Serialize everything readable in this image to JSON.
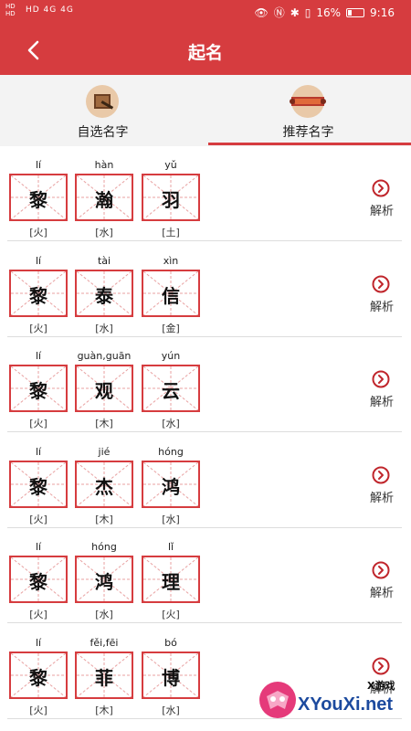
{
  "status_bar": {
    "left_indicators": "HD 4G 4G",
    "battery": "16%",
    "time": "9:16"
  },
  "header": {
    "title": "起名"
  },
  "tabs": [
    {
      "label": "自选名字",
      "active": false
    },
    {
      "label": "推荐名字",
      "active": true
    }
  ],
  "names": [
    {
      "chars": [
        {
          "pinyin": "lí",
          "hanzi": "黎",
          "element": "[火]"
        },
        {
          "pinyin": "hàn",
          "hanzi": "瀚",
          "element": "[水]"
        },
        {
          "pinyin": "yǔ",
          "hanzi": "羽",
          "element": "[土]"
        }
      ],
      "action": "解析"
    },
    {
      "chars": [
        {
          "pinyin": "lí",
          "hanzi": "黎",
          "element": "[火]"
        },
        {
          "pinyin": "tài",
          "hanzi": "泰",
          "element": "[水]"
        },
        {
          "pinyin": "xìn",
          "hanzi": "信",
          "element": "[金]"
        }
      ],
      "action": "解析"
    },
    {
      "chars": [
        {
          "pinyin": "lí",
          "hanzi": "黎",
          "element": "[火]"
        },
        {
          "pinyin": "guàn,guān",
          "hanzi": "观",
          "element": "[木]"
        },
        {
          "pinyin": "yún",
          "hanzi": "云",
          "element": "[水]"
        }
      ],
      "action": "解析"
    },
    {
      "chars": [
        {
          "pinyin": "lí",
          "hanzi": "黎",
          "element": "[火]"
        },
        {
          "pinyin": "jié",
          "hanzi": "杰",
          "element": "[木]"
        },
        {
          "pinyin": "hóng",
          "hanzi": "鸿",
          "element": "[水]"
        }
      ],
      "action": "解析"
    },
    {
      "chars": [
        {
          "pinyin": "lí",
          "hanzi": "黎",
          "element": "[火]"
        },
        {
          "pinyin": "hóng",
          "hanzi": "鸿",
          "element": "[水]"
        },
        {
          "pinyin": "lǐ",
          "hanzi": "理",
          "element": "[火]"
        }
      ],
      "action": "解析"
    },
    {
      "chars": [
        {
          "pinyin": "lí",
          "hanzi": "黎",
          "element": "[火]"
        },
        {
          "pinyin": "fěi,fēi",
          "hanzi": "菲",
          "element": "[木]"
        },
        {
          "pinyin": "bó",
          "hanzi": "博",
          "element": "[水]"
        }
      ],
      "action": "解析"
    }
  ],
  "watermark": {
    "top": "X游戏",
    "main": "XYouXi.net"
  },
  "colors": {
    "accent": "#d63c3f",
    "tab_bg": "#f3f3f3"
  }
}
